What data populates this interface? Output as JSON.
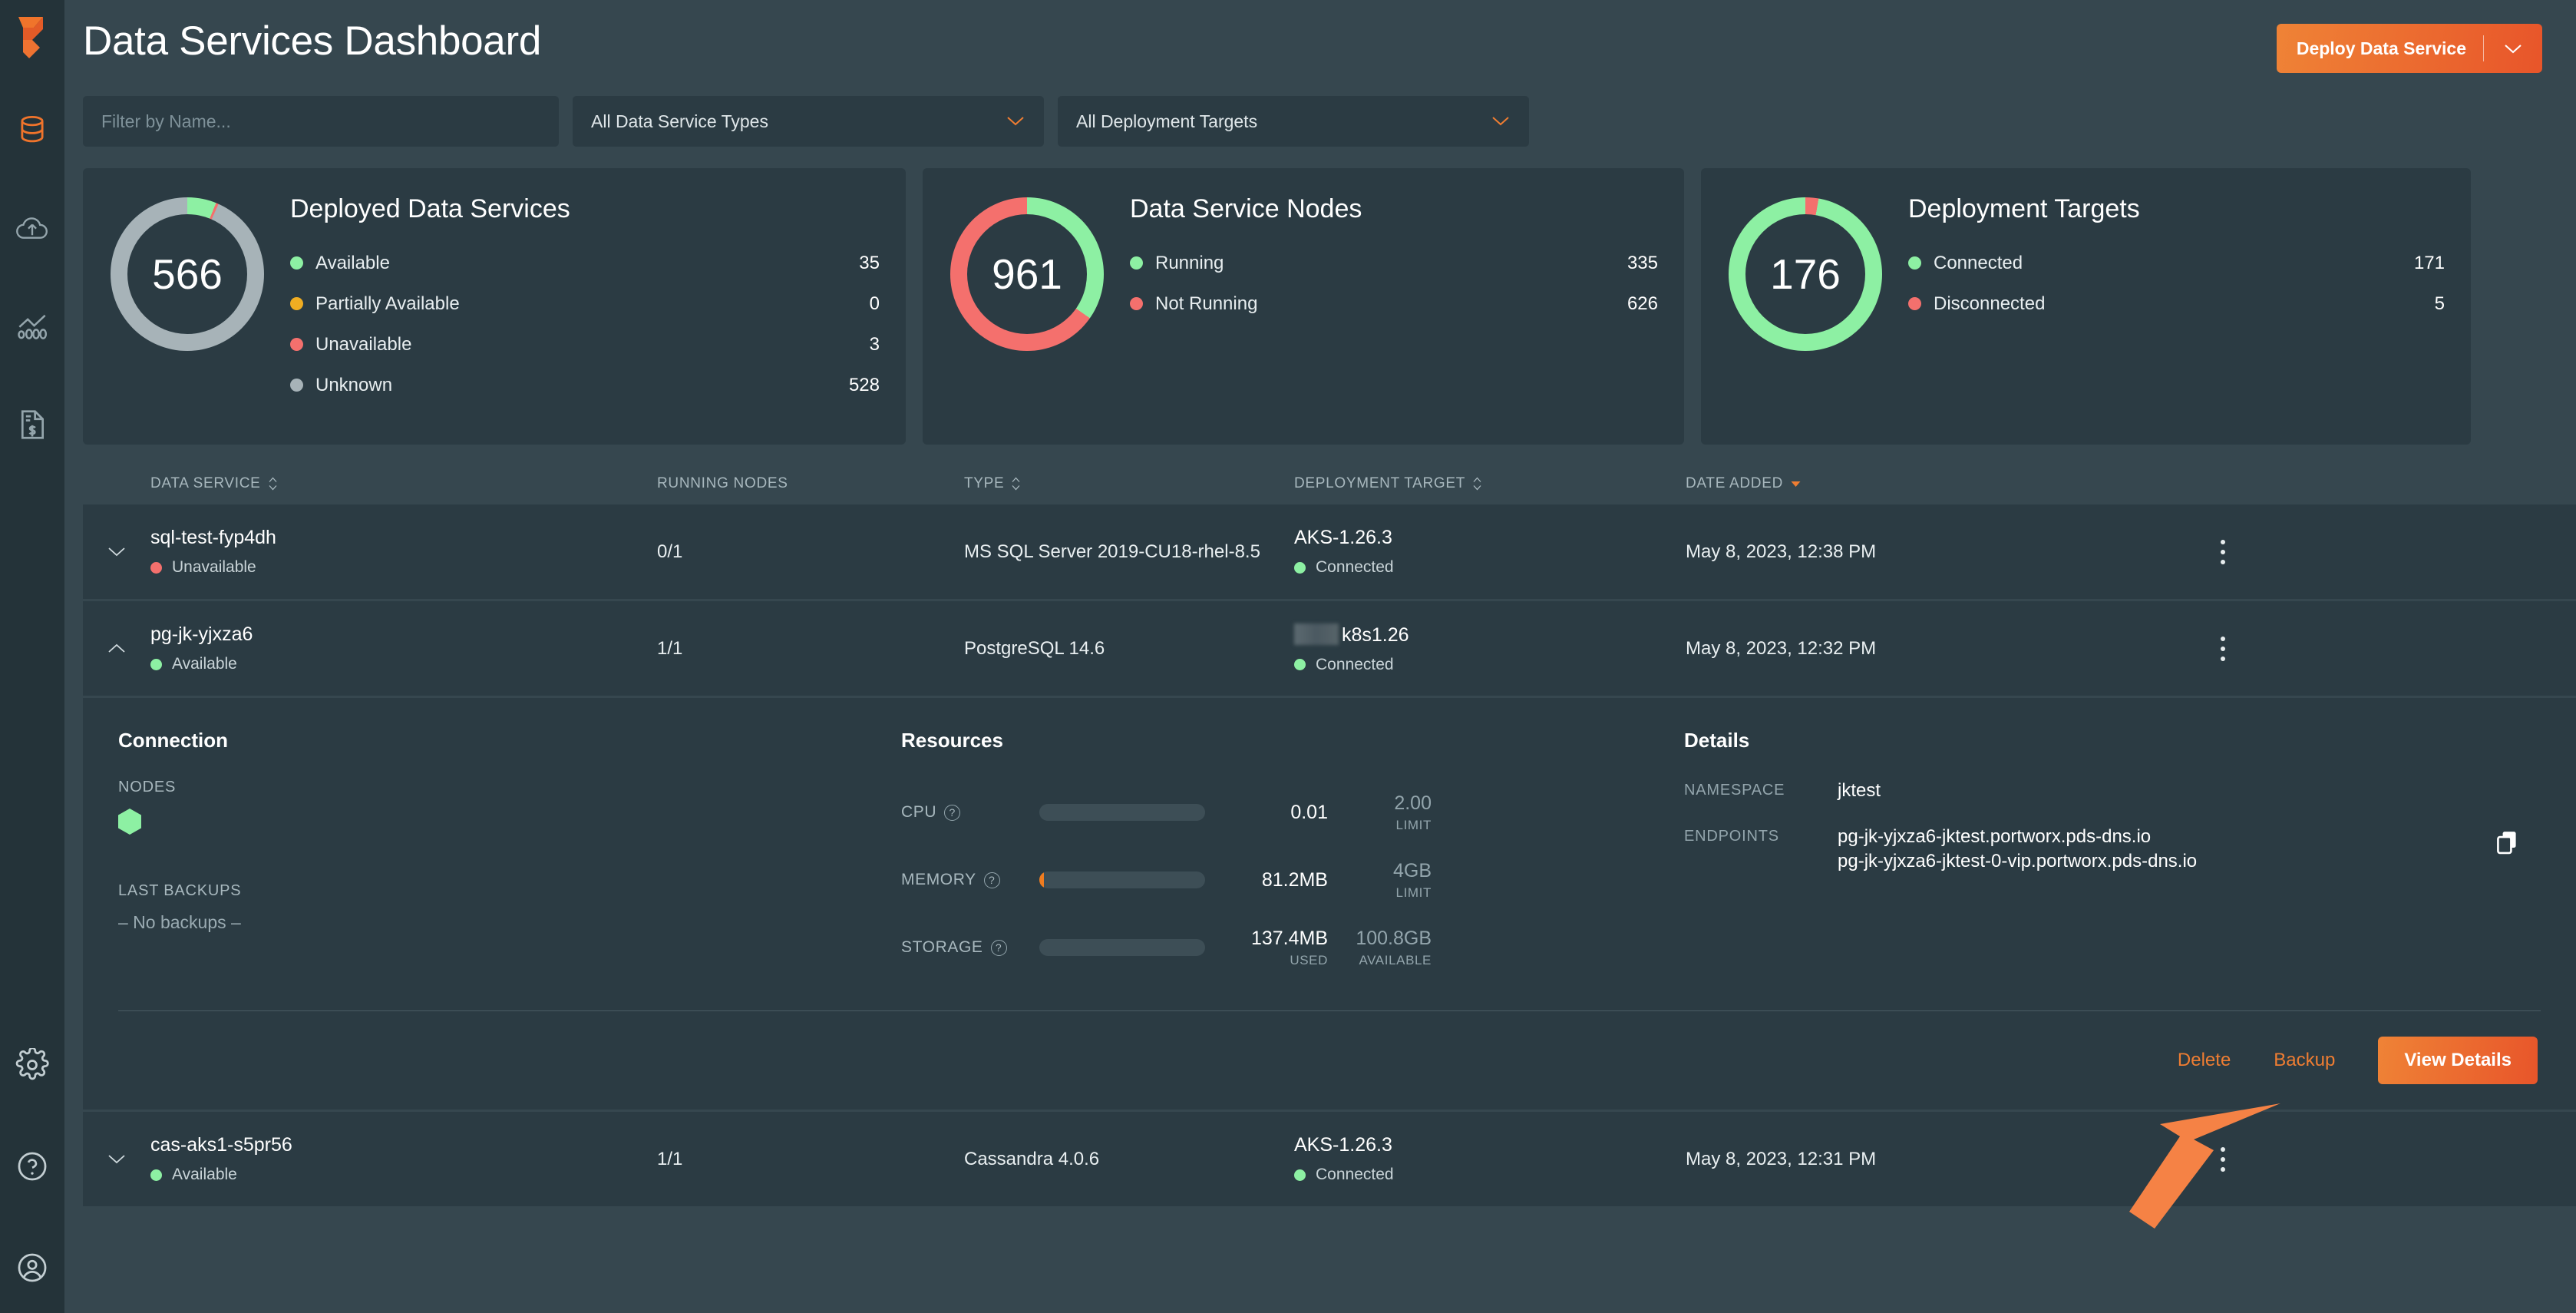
{
  "app": {
    "brand_orange": "#ef7d32",
    "green": "#8df0a3",
    "red": "#f4706d",
    "amber": "#f0ad22",
    "grey": "#a7b3b8"
  },
  "sidebar": {
    "logo_name": "portworx-logo",
    "items": [
      {
        "icon": "database-icon",
        "active": true
      },
      {
        "icon": "cloud-upload-icon",
        "active": false
      },
      {
        "icon": "metrics-chart-icon",
        "active": false
      },
      {
        "icon": "billing-document-icon",
        "active": false
      }
    ],
    "bottom_items": [
      {
        "icon": "gear-icon"
      },
      {
        "icon": "help-circle-icon"
      },
      {
        "icon": "user-account-icon"
      }
    ]
  },
  "header": {
    "title": "Data Services Dashboard",
    "deploy_button": "Deploy Data Service",
    "deploy_caret": "chevron-down-icon"
  },
  "filters": {
    "name_placeholder": "Filter by Name...",
    "name_value": "",
    "type_select": "All Data Service Types",
    "target_select": "All Deployment Targets"
  },
  "cards": [
    {
      "total": "566",
      "title": "Deployed Data Services",
      "legend": [
        {
          "label": "Available",
          "value": "35",
          "color": "#8df0a3"
        },
        {
          "label": "Partially Available",
          "value": "0",
          "color": "#f0ad22"
        },
        {
          "label": "Unavailable",
          "value": "3",
          "color": "#f4706d"
        },
        {
          "label": "Unknown",
          "value": "528",
          "color": "#a7b3b8"
        }
      ],
      "donut_css": "conic-gradient(#8df0a3 0deg 22deg, #f4706d 22deg 24deg, #a7b3b8 24deg 360deg)"
    },
    {
      "total": "961",
      "title": "Data Service Nodes",
      "legend": [
        {
          "label": "Running",
          "value": "335",
          "color": "#8df0a3"
        },
        {
          "label": "Not Running",
          "value": "626",
          "color": "#f4706d"
        }
      ],
      "donut_css": "conic-gradient(#8df0a3 0deg 125deg, #f4706d 125deg 360deg)"
    },
    {
      "total": "176",
      "title": "Deployment Targets",
      "legend": [
        {
          "label": "Connected",
          "value": "171",
          "color": "#8df0a3"
        },
        {
          "label": "Disconnected",
          "value": "5",
          "color": "#f4706d"
        }
      ],
      "donut_css": "conic-gradient(#f4706d 0deg 10deg, #8df0a3 10deg 360deg)"
    }
  ],
  "table": {
    "columns": [
      {
        "label": "Data Service",
        "sort": "both"
      },
      {
        "label": "Running Nodes",
        "sort": "none"
      },
      {
        "label": "Type",
        "sort": "both"
      },
      {
        "label": "Deployment Target",
        "sort": "both"
      },
      {
        "label": "Date Added",
        "sort": "desc"
      }
    ],
    "rows": [
      {
        "expanded": false,
        "chevron": "chevron-down-icon",
        "name": "sql-test-fyp4dh",
        "status": "Unavailable",
        "status_color": "#f4706d",
        "running_nodes": "0/1",
        "type": "MS SQL Server 2019-CU18-rhel-8.5",
        "target": "AKS-1.26.3",
        "target_redacted": false,
        "target_status": "Connected",
        "target_status_color": "#8df0a3",
        "date_added": "May 8, 2023, 12:38 PM"
      },
      {
        "expanded": true,
        "chevron": "chevron-up-icon",
        "name": "pg-jk-yjxza6",
        "status": "Available",
        "status_color": "#8df0a3",
        "running_nodes": "1/1",
        "type": "PostgreSQL 14.6",
        "target": "k8s1.26",
        "target_redacted": true,
        "target_status": "Connected",
        "target_status_color": "#8df0a3",
        "date_added": "May 8, 2023, 12:32 PM"
      },
      {
        "expanded": false,
        "chevron": "chevron-down-icon",
        "name": "cas-aks1-s5pr56",
        "status": "Available",
        "status_color": "#8df0a3",
        "running_nodes": "1/1",
        "type": "Cassandra 4.0.6",
        "target": "AKS-1.26.3",
        "target_redacted": false,
        "target_status": "Connected",
        "target_status_color": "#8df0a3",
        "date_added": "May 8, 2023, 12:31 PM"
      }
    ]
  },
  "panel": {
    "connection": {
      "heading": "Connection",
      "nodes_label": "Nodes",
      "node_status_color": "#8df0a3",
      "backups_label": "Last Backups",
      "backups_value": "– No backups –"
    },
    "resources": {
      "heading": "Resources",
      "rows": [
        {
          "name": "CPU",
          "used": "0.01",
          "used_sub": "",
          "limit": "2.00",
          "limit_sub": "Limit",
          "pct": 0
        },
        {
          "name": "Memory",
          "used": "81.2MB",
          "used_sub": "",
          "limit": "4GB",
          "limit_sub": "Limit",
          "pct": 3
        },
        {
          "name": "Storage",
          "used": "137.4MB",
          "used_sub": "Used",
          "limit": "100.8GB",
          "limit_sub": "Available",
          "pct": 0
        }
      ]
    },
    "details": {
      "heading": "Details",
      "namespace_label": "Namespace",
      "namespace_value": "jktest",
      "endpoints_label": "Endpoints",
      "endpoint_1": "pg-jk-yjxza6-jktest.portworx.pds-dns.io",
      "endpoint_2": "pg-jk-yjxza6-jktest-0-vip.portworx.pds-dns.io",
      "copy_icon": "copy-icon"
    },
    "actions": {
      "delete": "Delete",
      "backup": "Backup",
      "view_details": "View Details"
    }
  },
  "annotation": {
    "arrow": "orange-arrow-pointing-to-delete"
  }
}
